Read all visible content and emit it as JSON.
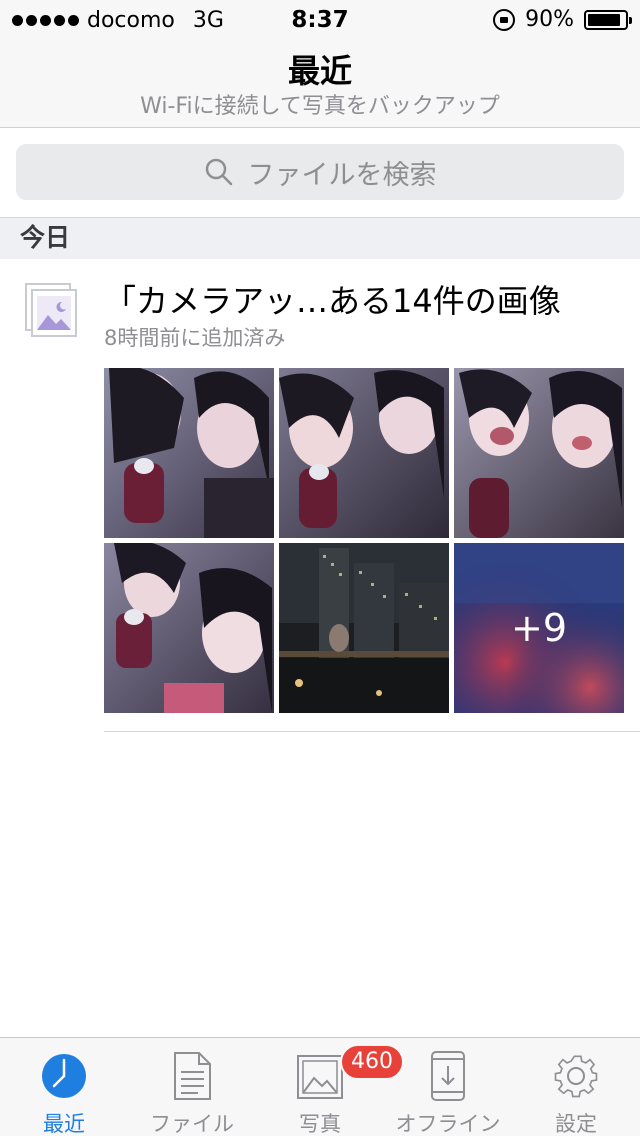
{
  "status_bar": {
    "carrier": "docomo",
    "network": "3G",
    "time": "8:37",
    "battery": "90%",
    "battery_level": 0.9,
    "signal_bars": 5
  },
  "nav": {
    "title": "最近",
    "subtitle": "Wi-Fiに接続して写真をバックアップ"
  },
  "search": {
    "placeholder": "ファイルを検索"
  },
  "section": {
    "header": "今日"
  },
  "entry": {
    "title": "「カメラアッ…ある14件の画像",
    "subtitle": "8時間前に追加済み",
    "more_count": "+9"
  },
  "tabs": [
    {
      "label": "最近",
      "icon": "clock-icon",
      "active": true
    },
    {
      "label": "ファイル",
      "icon": "document-icon"
    },
    {
      "label": "写真",
      "icon": "photo-icon",
      "badge": "460"
    },
    {
      "label": "オフライン",
      "icon": "phone-download-icon"
    },
    {
      "label": "設定",
      "icon": "gear-icon"
    }
  ],
  "colors": {
    "accent": "#1f7fe0",
    "badge": "#e8413a",
    "secondary_text": "#8e8e93"
  }
}
